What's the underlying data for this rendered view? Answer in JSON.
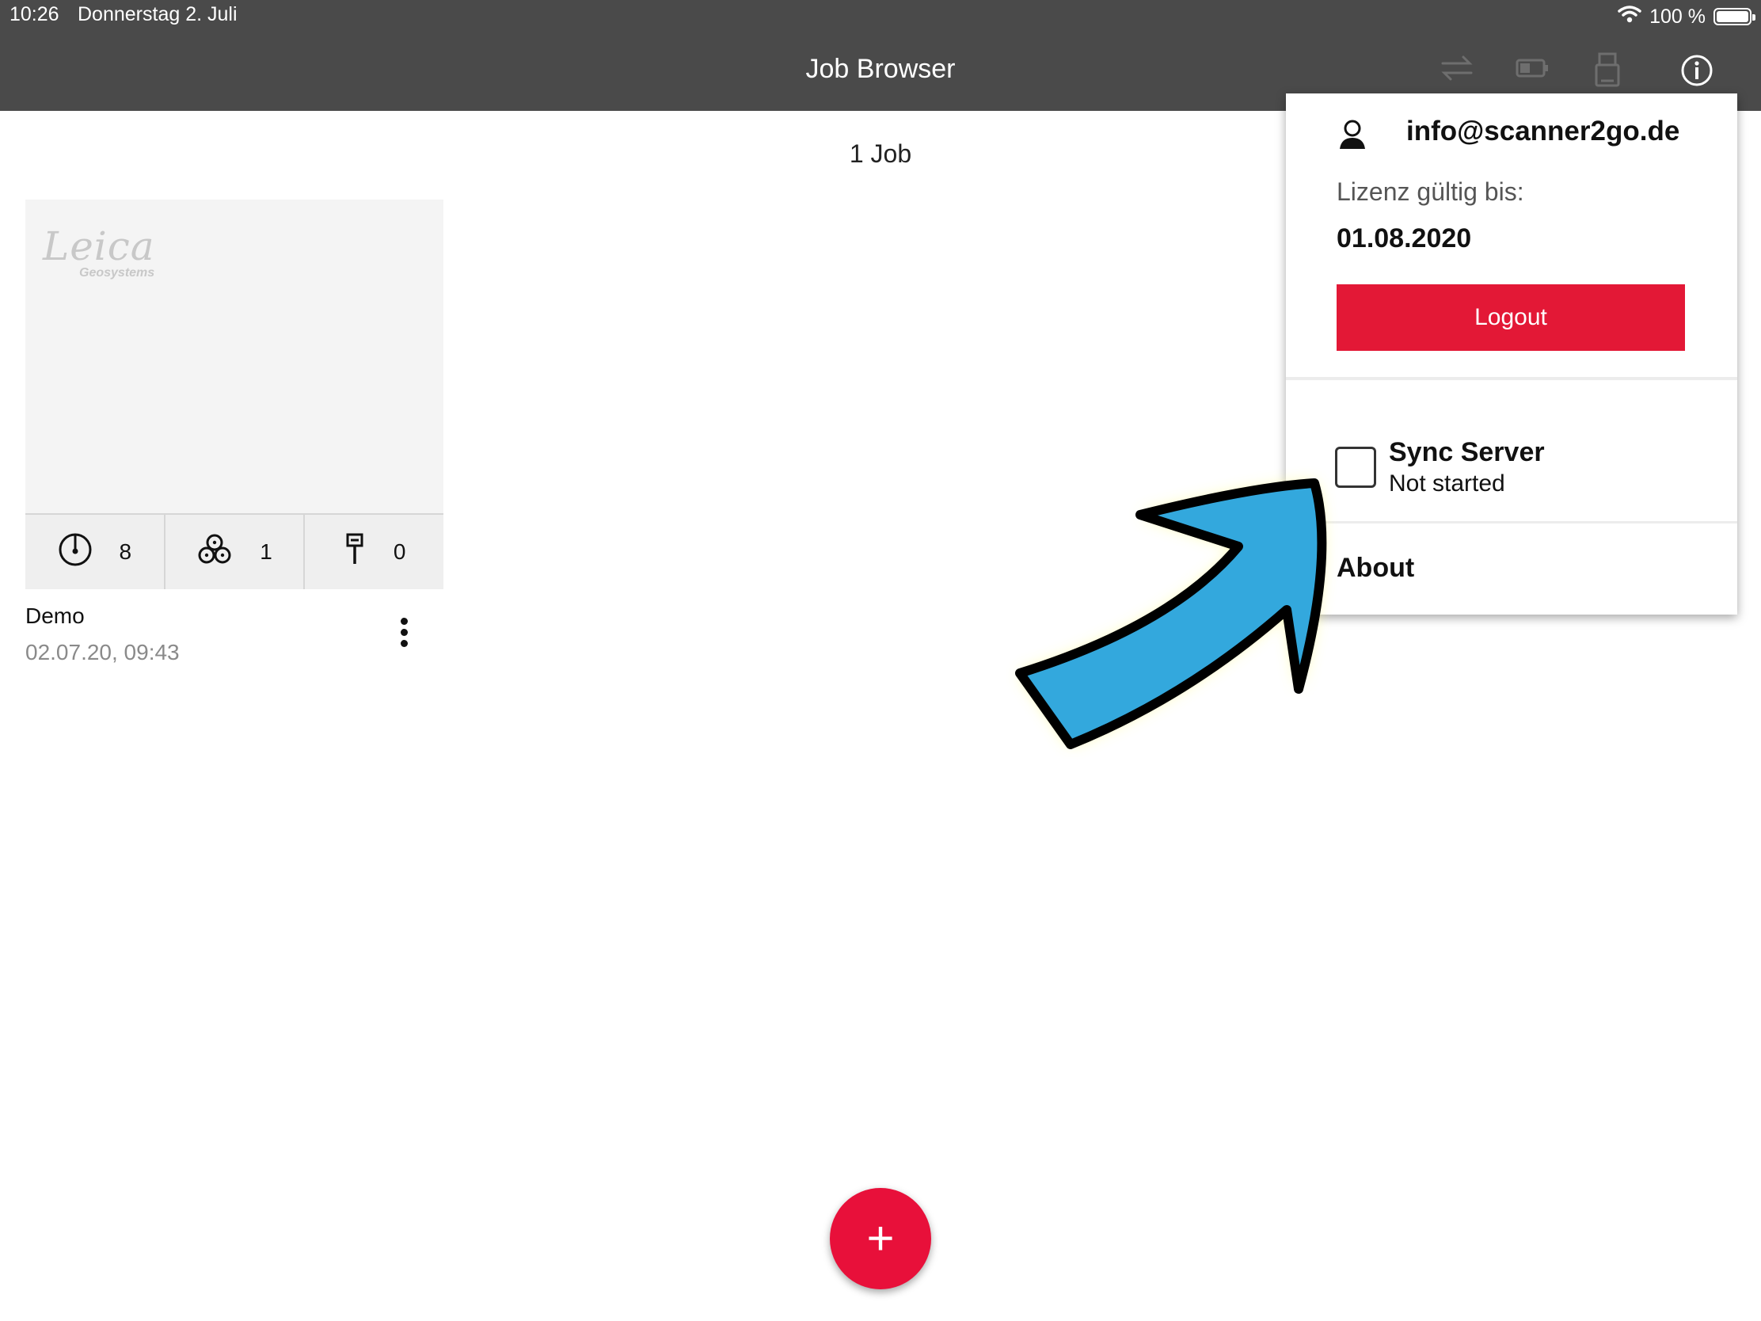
{
  "status_bar": {
    "time": "10:26",
    "date": "Donnerstag 2. Juli",
    "battery": "100 %",
    "wifi_icon": "wifi-icon",
    "battery_icon": "battery-icon"
  },
  "header": {
    "title": "Job Browser",
    "icons": [
      "sync-arrows-icon",
      "battery-status-icon",
      "usb-drive-icon",
      "info-icon"
    ]
  },
  "main": {
    "job_count": "1 Job",
    "jobs": [
      {
        "name": "Demo",
        "date": "02.07.20, 09:43",
        "logo_text": "Leica",
        "logo_sub": "Geosystems",
        "stats": {
          "setups": "8",
          "clusters": "1",
          "targets": "0"
        }
      }
    ],
    "add_button": "+"
  },
  "account_menu": {
    "email": "info@scanner2go.de",
    "license_label": "Lizenz gültig bis:",
    "license_date": "01.08.2020",
    "logout_label": "Logout",
    "sync_title": "Sync Server",
    "sync_status": "Not started",
    "about_label": "About"
  },
  "colors": {
    "topbar": "#4a4a4a",
    "accent_red": "#e31836",
    "fab_red": "#e8103a",
    "annotation_arrow": "#33a8dd"
  }
}
